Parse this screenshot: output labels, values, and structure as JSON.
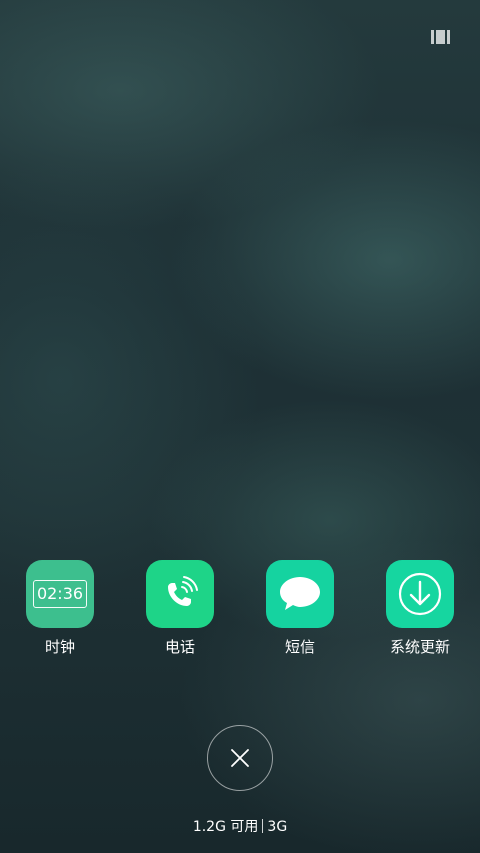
{
  "apps": [
    {
      "id": "clock",
      "label": "时钟",
      "display_time": "02:36",
      "icon": "clock-icon",
      "color": "#3dbf8e"
    },
    {
      "id": "phone",
      "label": "电话",
      "icon": "phone-icon",
      "color": "#1ed488"
    },
    {
      "id": "messages",
      "label": "短信",
      "icon": "message-bubble-icon",
      "color": "#15d3a0"
    },
    {
      "id": "system_update",
      "label": "系统更新",
      "icon": "download-arrow-icon",
      "color": "#16d6a0"
    }
  ],
  "close_button": {
    "icon": "close-icon"
  },
  "memory": {
    "available": "1.2G 可用",
    "total": "3G"
  },
  "top_right": {
    "icon": "layout-toggle-icon"
  }
}
